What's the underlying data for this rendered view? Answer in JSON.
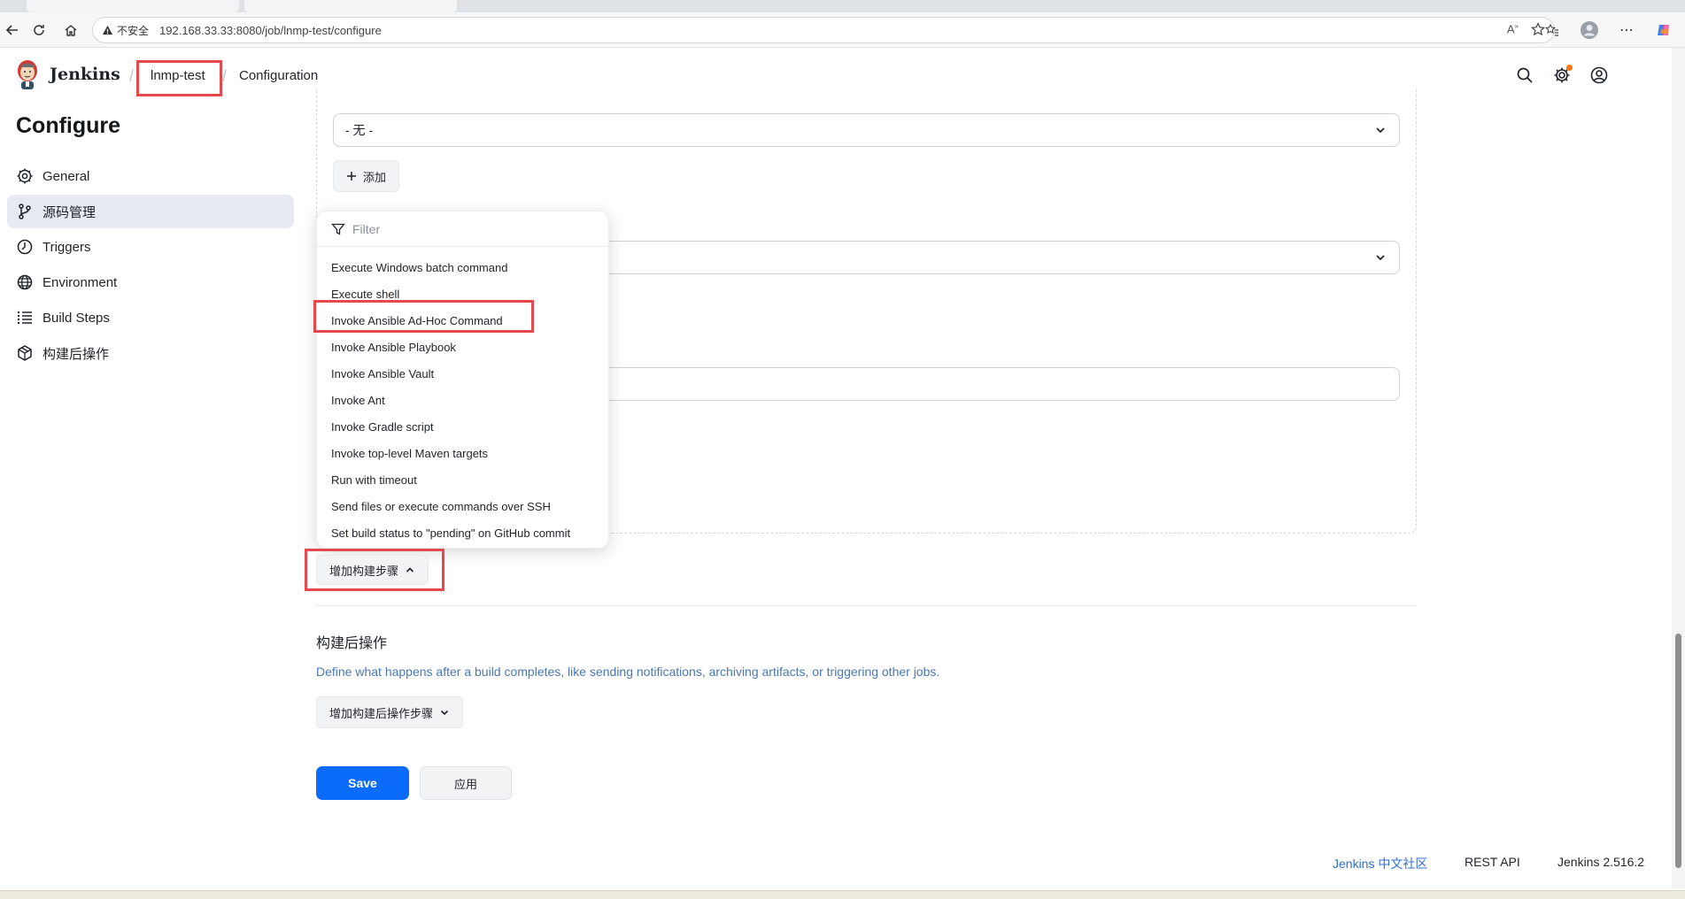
{
  "browser": {
    "security_label": "不安全",
    "url": "192.168.33.33:8080/job/lnmp-test/configure"
  },
  "header": {
    "logo_text": "Jenkins",
    "breadcrumbs": [
      "lnmp-test",
      "Configuration"
    ]
  },
  "page": {
    "title": "Configure"
  },
  "sidebar": {
    "items": [
      {
        "label": "General",
        "icon": "gear-icon"
      },
      {
        "label": "源码管理",
        "icon": "branch-icon",
        "active": true
      },
      {
        "label": "Triggers",
        "icon": "clock-icon"
      },
      {
        "label": "Environment",
        "icon": "globe-icon"
      },
      {
        "label": "Build Steps",
        "icon": "list-icon"
      },
      {
        "label": "构建后操作",
        "icon": "package-icon"
      }
    ]
  },
  "main": {
    "select_value": "- 无 -",
    "add_button": "添加",
    "filter_placeholder": "Filter",
    "dropdown_items": [
      "Execute Windows batch command",
      "Execute shell",
      "Invoke Ansible Ad-Hoc Command",
      "Invoke Ansible Playbook",
      "Invoke Ansible Vault",
      "Invoke Ant",
      "Invoke Gradle script",
      "Invoke top-level Maven targets",
      "Run with timeout",
      "Send files or execute commands over SSH",
      "Set build status to \"pending\" on GitHub commit"
    ],
    "add_build_step": "增加构建步骤",
    "post_build": {
      "title": "构建后操作",
      "description": "Define what happens after a build completes, like sending notifications, archiving artifacts, or triggering other jobs.",
      "add_button": "增加构建后操作步骤"
    },
    "save_label": "Save",
    "apply_label": "应用"
  },
  "footer": {
    "community": "Jenkins 中文社区",
    "rest_api": "REST API",
    "version": "Jenkins 2.516.2"
  },
  "colors": {
    "accent": "#0b6bfa",
    "highlight": "#e5484d",
    "link": "#4a78b5"
  }
}
